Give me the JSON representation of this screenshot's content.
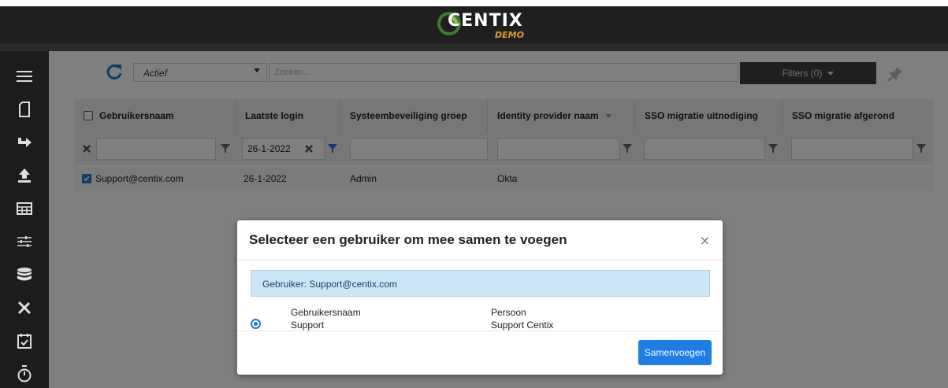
{
  "app": {
    "brand": "CENTIX",
    "brand_sub": "DEMO"
  },
  "sidebar": {
    "items": [
      {
        "icon": "hamburger-menu-icon"
      },
      {
        "icon": "document-icon"
      },
      {
        "icon": "arrow-redirect-icon"
      },
      {
        "icon": "upload-icon"
      },
      {
        "icon": "table-grid-icon"
      },
      {
        "icon": "sliders-icon"
      },
      {
        "icon": "database-icon"
      },
      {
        "icon": "tools-icon"
      },
      {
        "icon": "calendar-check-icon"
      },
      {
        "icon": "stopwatch-icon"
      }
    ]
  },
  "toolbar": {
    "status_value": "Actief",
    "search_placeholder": "Zoeken...",
    "filters_label": "Filters (0)"
  },
  "table": {
    "columns": [
      "Gebruikersnaam",
      "Laatste login",
      "Systeembeveiliging groep",
      "Identity provider naam",
      "SSO migratie uitnodiging",
      "SSO migratie afgerond"
    ],
    "filter_values": {
      "laatste_login": "26-1-2022"
    },
    "rows": [
      {
        "gebruikersnaam": "Support@centix.com",
        "laatste_login": "26-1-2022",
        "groep": "Admin",
        "idp": "Okta",
        "sso_uitnodiging": "",
        "sso_afgerond": ""
      }
    ]
  },
  "modal": {
    "title": "Selecteer een gebruiker om mee samen te voegen",
    "close": "×",
    "alert": "Gebruiker: Support@centix.com",
    "col1_header": "Gebruikersnaam",
    "col1_value": "Support",
    "col2_header": "Persoon",
    "col2_value": "Support Centix",
    "merge_button": "Samenvoegen"
  },
  "colors": {
    "header_bg": "#1f1f1f",
    "sidebar_bg": "#1c1c1c",
    "accent_blue": "#1e7ee6",
    "alert_bg": "#cce6f8",
    "demo_orange": "#e09a2a"
  }
}
